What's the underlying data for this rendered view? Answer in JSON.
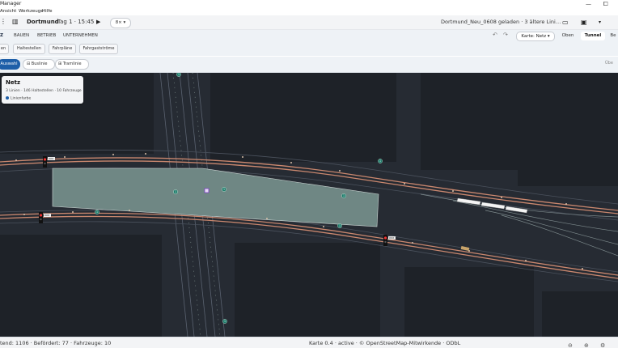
{
  "window": {
    "title": "Manager",
    "min": "—",
    "max": "⧠"
  },
  "menu": [
    "Ansicht",
    "Werkzeuge",
    "Hilfe"
  ],
  "header": {
    "city": "Dortmund",
    "time": "Tag 1 · 15:45",
    "speed": "8× ▾",
    "status": "Dortmund_Neu_0608 geladen · 3 ältere Lini…"
  },
  "tabs": [
    "Z",
    "BAUEN",
    "BETRIEB",
    "UNTERNEHMEN"
  ],
  "toolbar": {
    "karte": "Karte: Netz ▾",
    "oben": "Oben",
    "tunnel": "Tunnel",
    "be": "Be"
  },
  "subtools": [
    "en",
    "Haltestellen",
    "Fahrpläne",
    "Fahrgastströme"
  ],
  "filters": {
    "auswahl": "Auswahl",
    "buslinie": "Buslinie",
    "tramlinie": "Tramlinie",
    "right": "Übe"
  },
  "panel": {
    "title": "Netz",
    "summary": "3 Linien · 146 Haltestellen · 10 Fahrzeuge",
    "legend": "Linienfarbe"
  },
  "statusbar": {
    "left": "tend: 1106 · Befördert: 77 · Fahrzeuge: 10",
    "center": "Karte 0.4 · active · © OpenStreetMap-Mitwirkende · ODbL"
  },
  "map": {
    "stop_labels": [
      "1",
      "1",
      "1",
      "1",
      "1",
      "1",
      "1",
      "1"
    ],
    "signal_labels": [
      "XXX",
      "XXX",
      "XXX"
    ]
  },
  "colors": {
    "map_bg": "#262b33",
    "block_dark": "#1e2228",
    "zone_fill": "#6f8784",
    "route": "#c9876e",
    "accent": "#1e5fa8"
  }
}
